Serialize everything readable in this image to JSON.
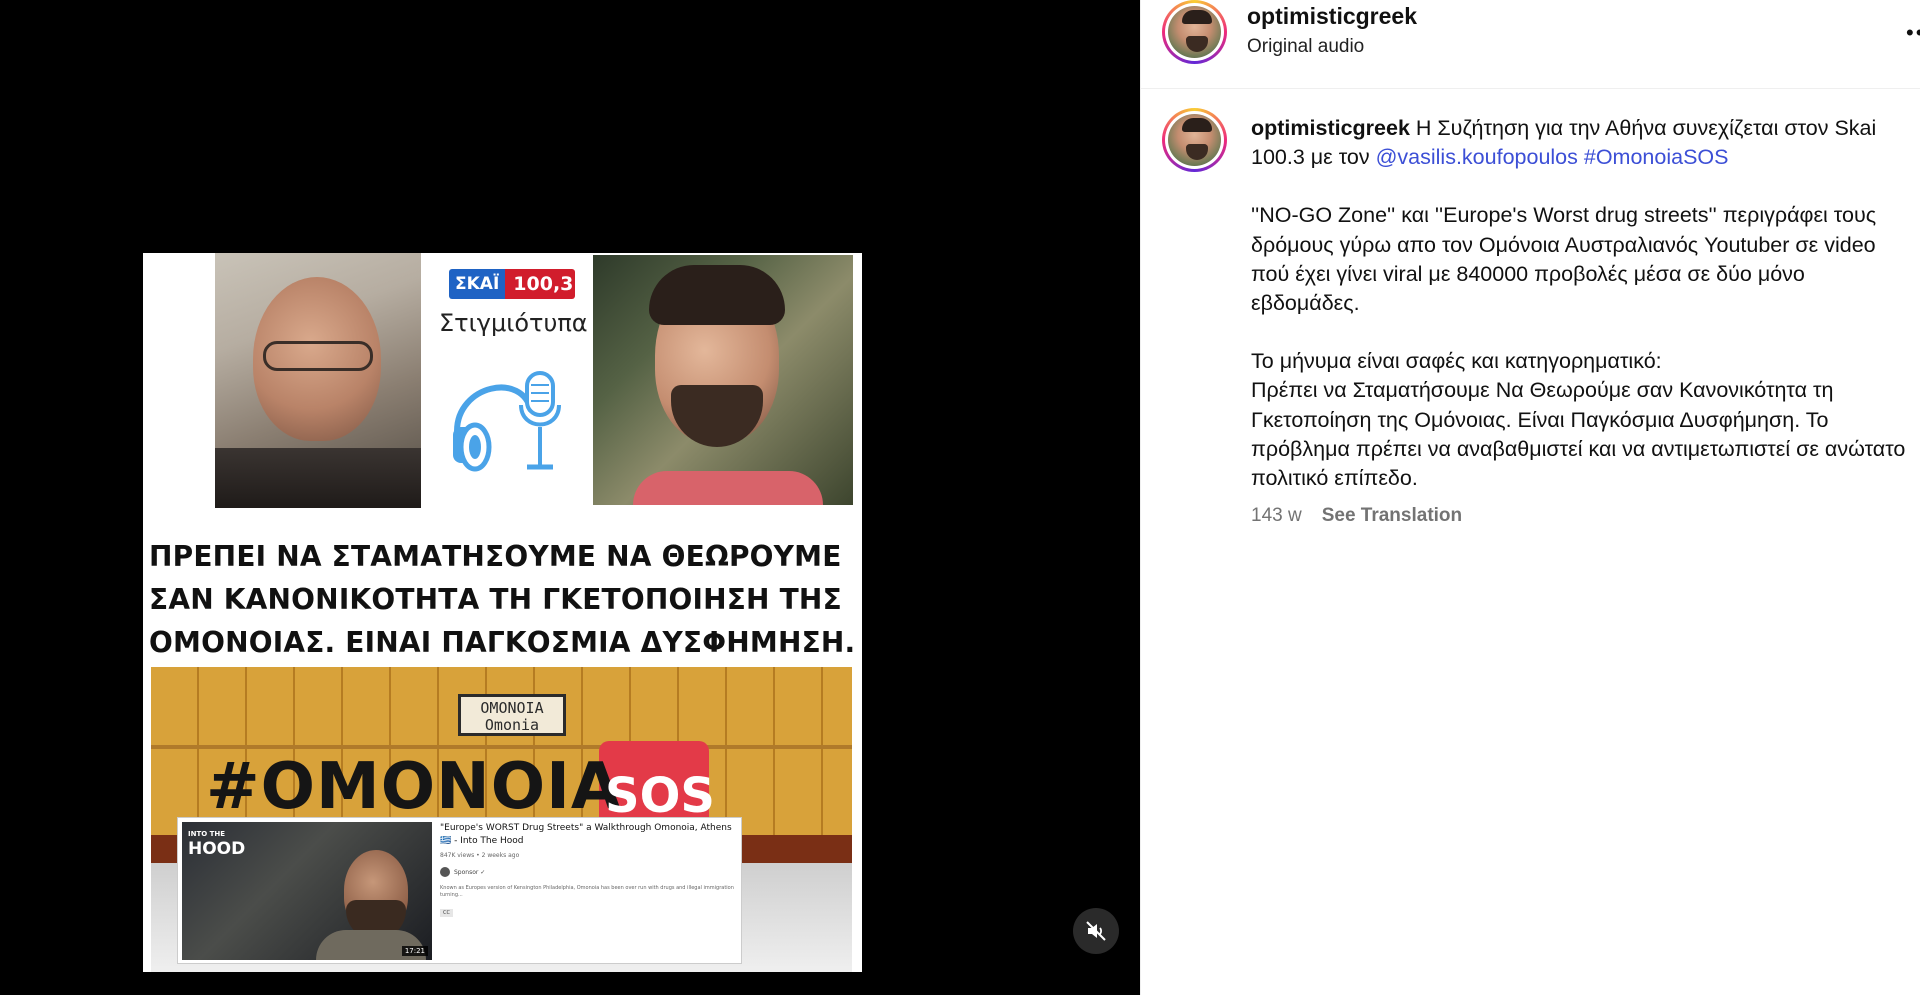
{
  "media": {
    "badge_left": "ΣΚΑΪ",
    "badge_right": "100,3",
    "segment_label": "Στιγμιότυπα",
    "headline_lines": [
      "ΠΡΕΠΕΙ ΝΑ ΣΤΑΜΑΤΗΣΟΥΜΕ ΝΑ ΘΕΩΡΟΥΜΕ",
      "ΣΑΝ ΚΑΝΟΝΙΚΟΤΗΤΑ ΤΗ ΓΚΕΤΟΠΟΙΗΣΗ ΤΗΣ",
      "ΟΜΟΝΟΙΑΣ. ΕΙΝΑΙ ΠΑΓΚΟΣΜΙΑ ΔΥΣΦΗΜΗΣΗ."
    ],
    "station_sign_top": "ΟΜΟΝΟΙΑ",
    "station_sign_bottom": "Omonia",
    "hashtag_text": "#ΟΜΟΝΟΙΑ",
    "hashtag_sos": "SOS",
    "video_card": {
      "thumb_logo_small": "INTO THE",
      "thumb_logo_big": "HOOD",
      "duration": "17:21",
      "title": "\"Europe's WORST Drug Streets\" a Walkthrough Omonoia, Athens 🇬🇷 - Into The Hood",
      "stats": "847K views • 2 weeks ago",
      "channel": "Sponsor ✓",
      "description": "Known as Europes version of Kensington Philadelphia, Omonoia has been over run with drugs and illegal immigration turning...",
      "cc": "CC"
    }
  },
  "post": {
    "username": "optimisticgreek",
    "audio_label": "Original audio",
    "more_label": "•••",
    "caption": {
      "username": "optimisticgreek",
      "line1_text": " Η Συζήτηση για την Αθήνα συνεχίζεται στον Skai 100.3 με τον ",
      "mention": "@vasilis.koufopoulos",
      "hashtag": "#OmonoiaSOS",
      "para2": "''NO-GO Zone'' και ''Europe's Worst drug streets'' περιγράφει τους δρόμους γύρω απο τον Ομόνοια Αυστραλιανός Youtuber σε video πού έχει γίνει viral με 840000 προβολές μέσα σε δύο μόνο εβδομάδες.",
      "para3_line1": "Το μήνυμα είναι σαφές και κατηγορηματικό:",
      "para3_rest": "Πρέπει να Σταματήσουμε Να Θεωρούμε σαν Κανονικότητα τη Γκετοποίηση της Ομόνοιας. Είναι Παγκόσμια Δυσφήμηση. Το πρόβλημα πρέπει να αναβαθμιστεί και να αντιμετωπιστεί σε ανώτατο πολιτικό επίπεδο.",
      "time_ago": "143 w",
      "translate_label": "See Translation"
    }
  },
  "colors": {
    "link": "#3c4fd6",
    "meta": "#737373",
    "skai_blue": "#1f63c4",
    "skai_red": "#d11d2c",
    "sos_red": "#e33a48"
  },
  "icons": {
    "mute": "speaker-muted-icon",
    "podcast": "headphones-microphone-icon"
  }
}
